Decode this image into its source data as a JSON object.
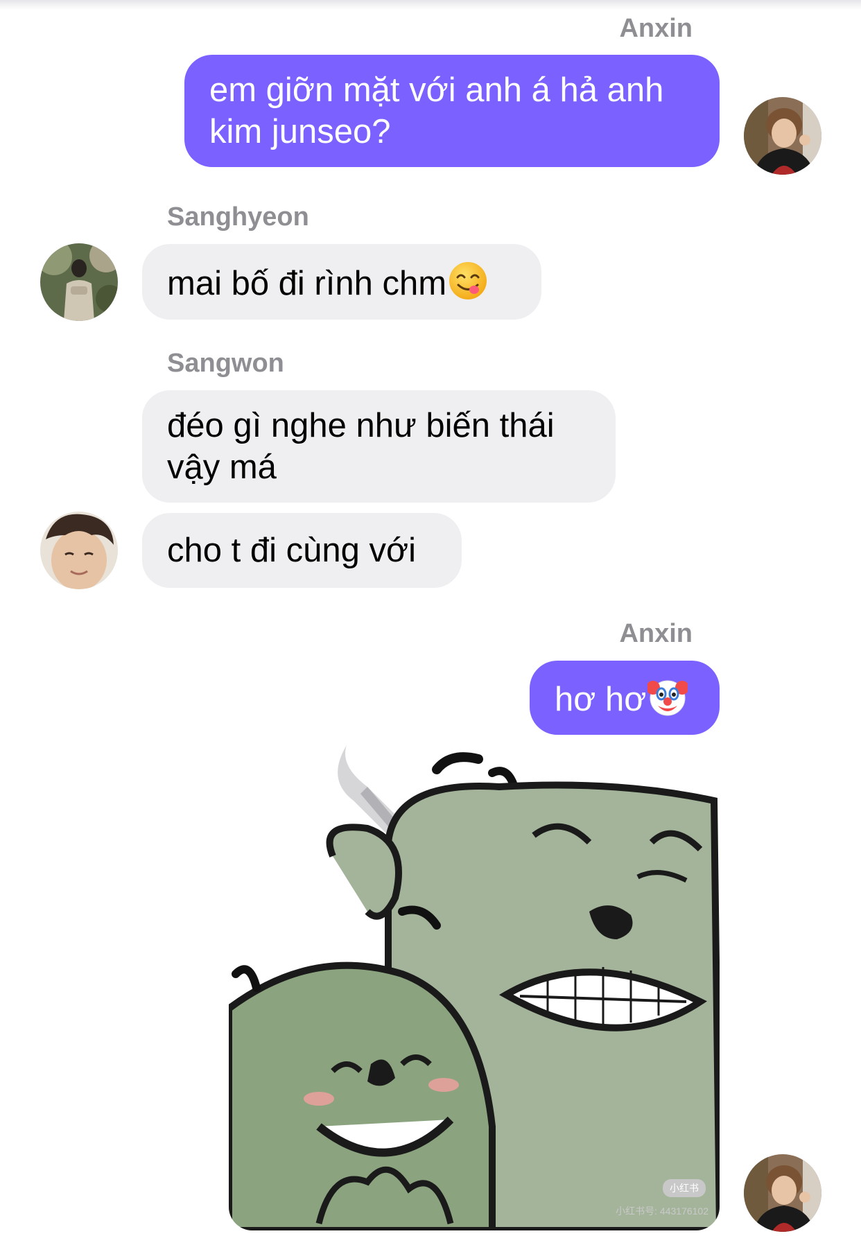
{
  "colors": {
    "outgoing_bubble": "#7b61ff",
    "incoming_bubble": "#efeff1",
    "sender_name": "#8e8e93"
  },
  "messages": [
    {
      "sender": "Anxin",
      "text": "em giỡn mặt với anh á hả anh kim junseo?",
      "direction": "outgoing"
    },
    {
      "sender": "Sanghyeon",
      "text": "mai bố đi rình chm",
      "emoji": "yum-face-emoji",
      "direction": "incoming"
    },
    {
      "sender": "Sangwon",
      "text": "đéo gì nghe như biến thái vậy má",
      "direction": "incoming"
    },
    {
      "text": "cho t đi cùng với",
      "direction": "incoming"
    },
    {
      "sender": "Anxin",
      "text": "hơ hơ",
      "emoji": "clown-face-emoji",
      "direction": "outgoing"
    }
  ],
  "sticker": {
    "description_icon": "melon-characters-sticker",
    "watermark_badge": "小红书",
    "watermark_text": "小红书号: 443176102"
  }
}
